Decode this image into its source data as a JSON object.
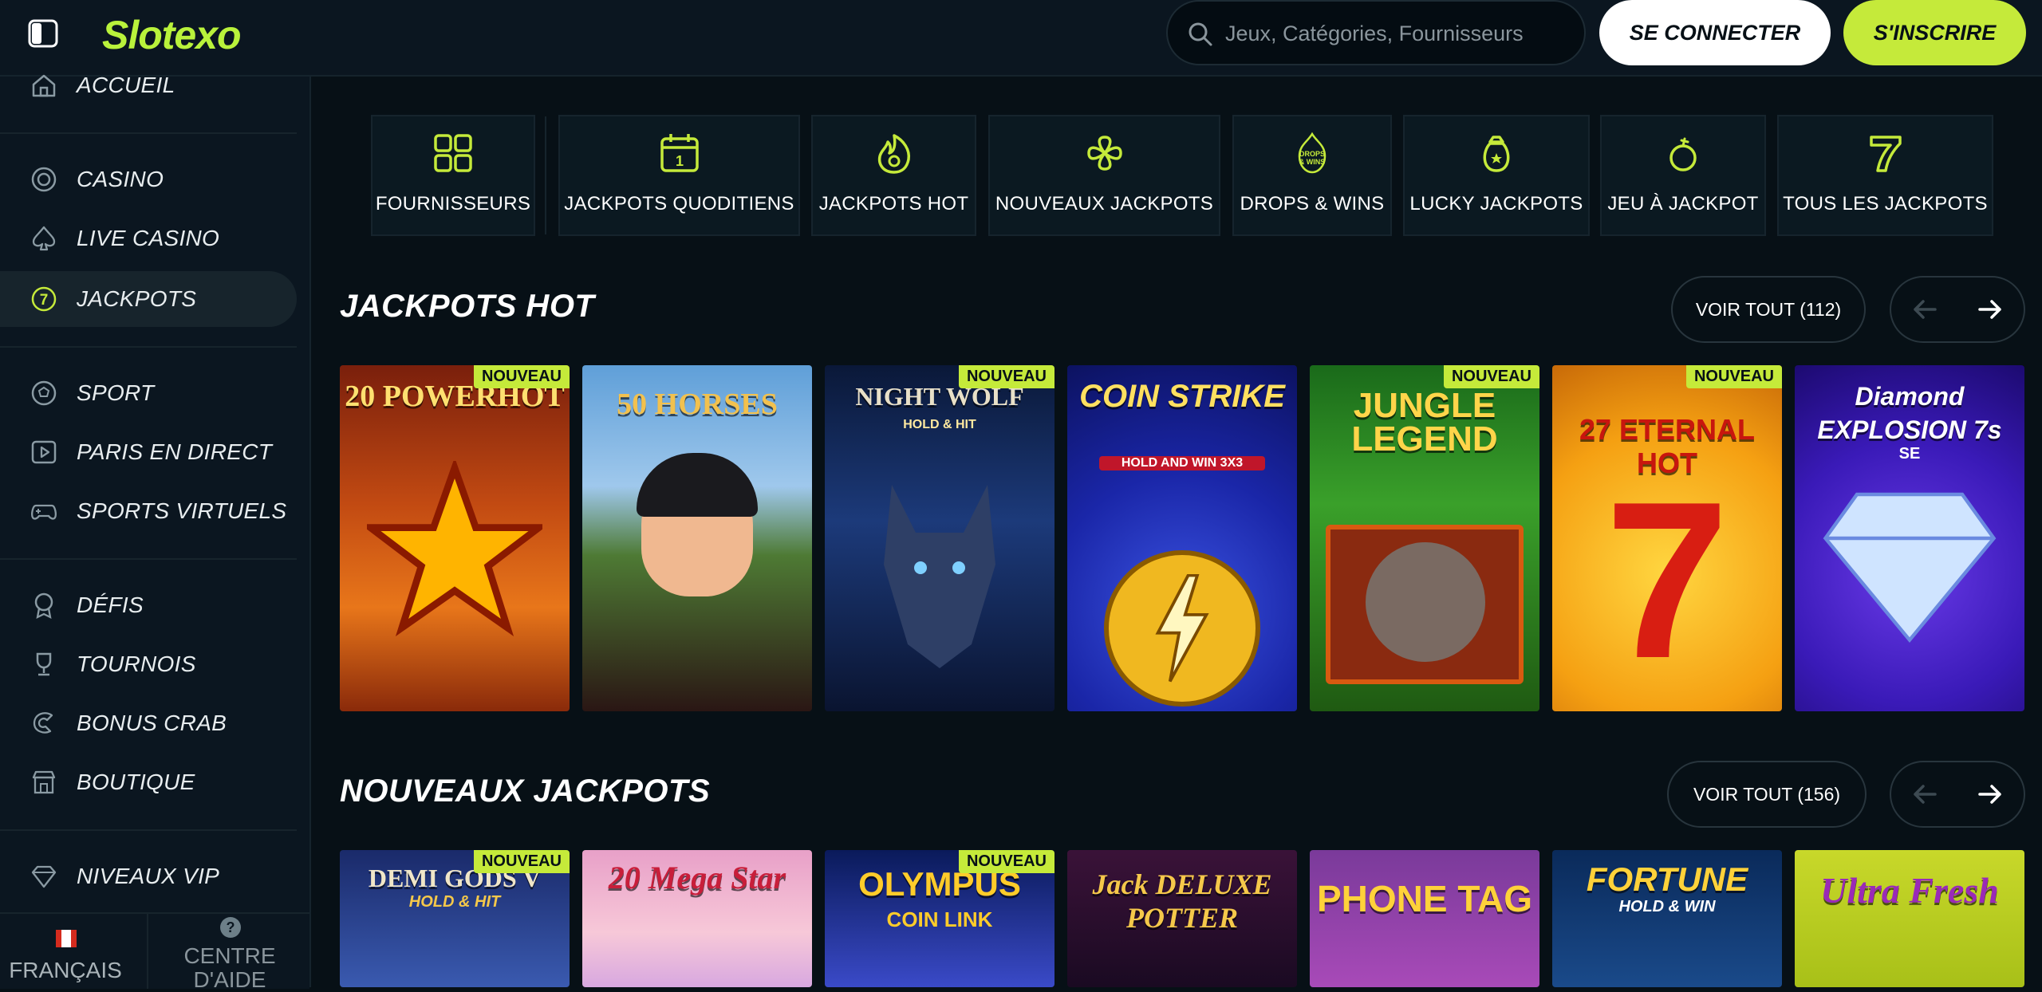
{
  "header": {
    "logo": "Slotexo",
    "search_placeholder": "Jeux, Catégories, Fournisseurs",
    "login_label": "SE CONNECTER",
    "signup_label": "S'INSCRIRE"
  },
  "sidebar": {
    "items": [
      {
        "label": "ACCUEIL",
        "icon": "home-icon"
      },
      {
        "label": "CASINO",
        "icon": "chip-icon"
      },
      {
        "label": "LIVE CASINO",
        "icon": "spade-icon"
      },
      {
        "label": "JACKPOTS",
        "icon": "seven-badge-icon",
        "active": true
      },
      {
        "label": "SPORT",
        "icon": "soccer-ball-icon"
      },
      {
        "label": "PARIS EN DIRECT",
        "icon": "play-screen-icon"
      },
      {
        "label": "SPORTS VIRTUELS",
        "icon": "gamepad-icon"
      },
      {
        "label": "DÉFIS",
        "icon": "award-icon"
      },
      {
        "label": "TOURNOIS",
        "icon": "trophy-icon"
      },
      {
        "label": "BONUS CRAB",
        "icon": "crab-claw-icon"
      },
      {
        "label": "BOUTIQUE",
        "icon": "shop-icon"
      },
      {
        "label": "NIVEAUX VIP",
        "icon": "diamond-icon"
      }
    ],
    "footer": {
      "language": "FRANÇAIS",
      "help_label": "CENTRE D'AIDE"
    }
  },
  "categories": [
    {
      "label": "FOURNISSEURS",
      "icon": "grid-icon"
    },
    {
      "label": "JACKPOTS QUODITIENS",
      "icon": "calendar-icon"
    },
    {
      "label": "JACKPOTS HOT",
      "icon": "flame-icon"
    },
    {
      "label": "NOUVEAUX JACKPOTS",
      "icon": "clover-icon"
    },
    {
      "label": "DROPS & WINS",
      "icon": "drops-wins-icon",
      "icon_text": "DROPS & WINS"
    },
    {
      "label": "LUCKY JACKPOTS",
      "icon": "money-bag-icon"
    },
    {
      "label": "JEU À JACKPOT",
      "icon": "bomb-icon"
    },
    {
      "label": "TOUS LES JACKPOTS",
      "icon": "seven-icon"
    }
  ],
  "sections": [
    {
      "title": "JACKPOTS HOT",
      "view_all": "VOIR TOUT (112)",
      "games": [
        {
          "title": "20 POWERHOT",
          "badge": "NOUVEAU"
        },
        {
          "title": "50 HORSES",
          "badge": ""
        },
        {
          "title": "NIGHT WOLF",
          "subtitle": "HOLD & HIT",
          "badge": "NOUVEAU"
        },
        {
          "title": "COIN STRIKE",
          "subtitle": "HOLD AND WIN 3X3",
          "badge": ""
        },
        {
          "title": "JUNGLE LEGEND",
          "badge": "NOUVEAU"
        },
        {
          "title": "27 ETERNAL HOT",
          "badge": "NOUVEAU"
        },
        {
          "title": "Diamond EXPLOSION 7s",
          "subtitle": "SE",
          "badge": ""
        }
      ]
    },
    {
      "title": "NOUVEAUX JACKPOTS",
      "view_all": "VOIR TOUT (156)",
      "games": [
        {
          "title": "DEMI GODS V",
          "subtitle": "HOLD & HIT",
          "badge": "NOUVEAU"
        },
        {
          "title": "20 Mega Star",
          "badge": ""
        },
        {
          "title": "OLYMPUS",
          "subtitle": "COIN LINK",
          "badge": "NOUVEAU"
        },
        {
          "title": "Jack DELUXE POTTER",
          "badge": ""
        },
        {
          "title": "PHONE TAG",
          "badge": ""
        },
        {
          "title": "FORTUNE",
          "subtitle": "HOLD & WIN",
          "badge": ""
        },
        {
          "title": "Ultra Fresh",
          "badge": ""
        }
      ]
    }
  ],
  "colors": {
    "accent": "#c5ea3a",
    "logo": "#b9f23b",
    "background": "#071016",
    "sidebar": "#0b1620"
  }
}
